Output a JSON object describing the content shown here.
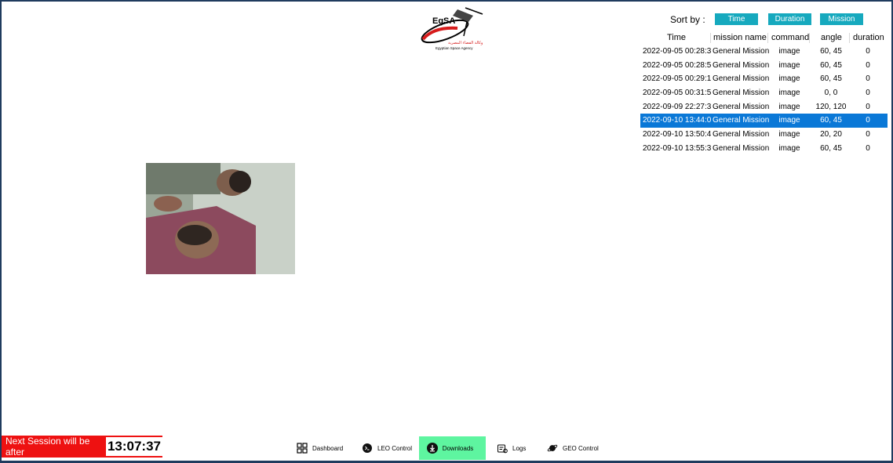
{
  "logo": {
    "abbr": "EgSA",
    "arabic": "وكالة الفضاء المصرية",
    "name": "Egyptian Space Agency"
  },
  "sort": {
    "label": "Sort by :",
    "buttons": [
      "Time",
      "Duration",
      "Mission"
    ]
  },
  "table": {
    "headers": [
      "Time",
      "mission name",
      "command",
      "angle",
      "duration"
    ],
    "rows": [
      {
        "time": "2022-09-05 00:28:3",
        "mission": "General Mission",
        "command": "image",
        "angle": "60, 45",
        "duration": "0"
      },
      {
        "time": "2022-09-05 00:28:5",
        "mission": "General Mission",
        "command": "image",
        "angle": "60, 45",
        "duration": "0"
      },
      {
        "time": "2022-09-05 00:29:1",
        "mission": "General Mission",
        "command": "image",
        "angle": "60, 45",
        "duration": "0"
      },
      {
        "time": "2022-09-05 00:31:5",
        "mission": "General Mission",
        "command": "image",
        "angle": "0, 0",
        "duration": "0"
      },
      {
        "time": "2022-09-09 22:27:3",
        "mission": "General Mission",
        "command": "image",
        "angle": "120, 120",
        "duration": "0"
      },
      {
        "time": "2022-09-10 13:44:0",
        "mission": "General Mission",
        "command": "image",
        "angle": "60, 45",
        "duration": "0",
        "selected": true
      },
      {
        "time": "2022-09-10 13:50:4",
        "mission": "General Mission",
        "command": "image",
        "angle": "20, 20",
        "duration": "0"
      },
      {
        "time": "2022-09-10 13:55:3",
        "mission": "General Mission",
        "command": "image",
        "angle": "60, 45",
        "duration": "0"
      }
    ]
  },
  "session": {
    "label": "Next Session will be after",
    "time": "13:07:37"
  },
  "nav": {
    "items": [
      {
        "label": "Dashboard",
        "icon": "grid-icon"
      },
      {
        "label": "LEO Control",
        "icon": "terminal-icon"
      },
      {
        "label": "Downloads",
        "icon": "download-icon",
        "active": true
      },
      {
        "label": "Logs",
        "icon": "logs-icon"
      },
      {
        "label": "GEO Control",
        "icon": "planet-icon"
      }
    ]
  },
  "colors": {
    "accent": "#16a9be",
    "selected_row": "#0a78d7",
    "active_nav": "#5ef5a0",
    "session_bg": "#ee1111",
    "frame": "#1f3b5e"
  }
}
